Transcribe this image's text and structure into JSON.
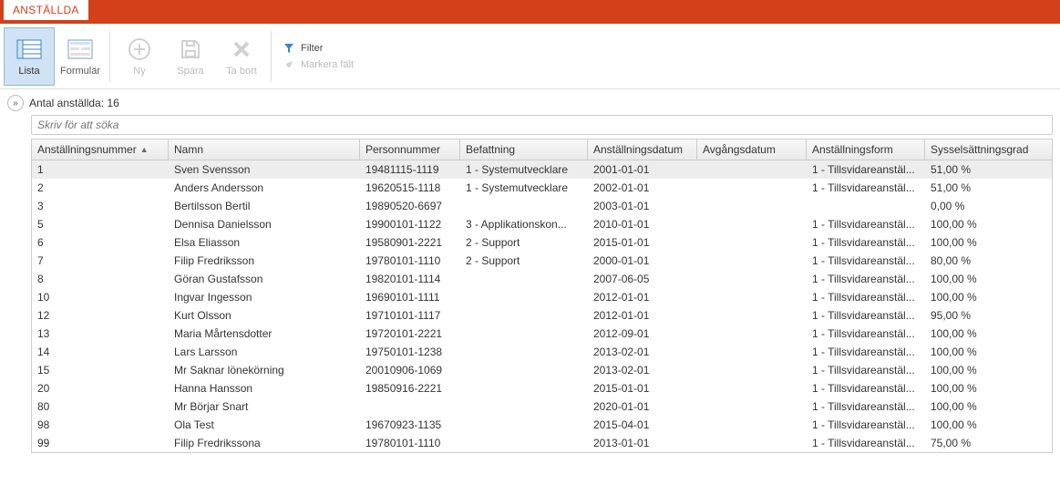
{
  "header": {
    "tab": "ANSTÄLLDA"
  },
  "toolbar": {
    "lista": "Lista",
    "formular": "Formulär",
    "ny": "Ny",
    "spara": "Spara",
    "tabort": "Ta bort",
    "filter": "Filter",
    "markera": "Markera fält"
  },
  "summary": {
    "label": "Antal anställda: 16"
  },
  "search": {
    "placeholder": "Skriv för att söka"
  },
  "columns": [
    "Anställningsnummer",
    "Namn",
    "Personnummer",
    "Befattning",
    "Anställningsdatum",
    "Avgångsdatum",
    "Anställningsform",
    "Sysselsättningsgrad"
  ],
  "rows": [
    {
      "anstnr": "1",
      "namn": "Sven Svensson",
      "pnr": "19481115-1119",
      "befattning": "1 - Systemutvecklare",
      "anstdatum": "2001-01-01",
      "avgangs": "",
      "form": "1 - Tillsvidareanstäl...",
      "grad": "51,00 %"
    },
    {
      "anstnr": "2",
      "namn": "Anders Andersson",
      "pnr": "19620515-1118",
      "befattning": "1 - Systemutvecklare",
      "anstdatum": "2002-01-01",
      "avgangs": "",
      "form": "1 - Tillsvidareanstäl...",
      "grad": "51,00 %"
    },
    {
      "anstnr": "3",
      "namn": "Bertilsson Bertil",
      "pnr": "19890520-6697",
      "befattning": "",
      "anstdatum": "2003-01-01",
      "avgangs": "",
      "form": "",
      "grad": "0,00 %"
    },
    {
      "anstnr": "5",
      "namn": "Dennisa Danielsson",
      "pnr": "19900101-1122",
      "befattning": "3 - Applikationskon...",
      "anstdatum": "2010-01-01",
      "avgangs": "",
      "form": "1 - Tillsvidareanstäl...",
      "grad": "100,00 %"
    },
    {
      "anstnr": "6",
      "namn": "Elsa Eliasson",
      "pnr": "19580901-2221",
      "befattning": "2 - Support",
      "anstdatum": "2015-01-01",
      "avgangs": "",
      "form": "1 - Tillsvidareanstäl...",
      "grad": "100,00 %"
    },
    {
      "anstnr": "7",
      "namn": "Filip Fredriksson",
      "pnr": "19780101-1110",
      "befattning": "2 - Support",
      "anstdatum": "2000-01-01",
      "avgangs": "",
      "form": "1 - Tillsvidareanstäl...",
      "grad": "80,00 %"
    },
    {
      "anstnr": "8",
      "namn": "Göran Gustafsson",
      "pnr": "19820101-1114",
      "befattning": "",
      "anstdatum": "2007-06-05",
      "avgangs": "",
      "form": "1 - Tillsvidareanstäl...",
      "grad": "100,00 %"
    },
    {
      "anstnr": "10",
      "namn": "Ingvar Ingesson",
      "pnr": "19690101-1111",
      "befattning": "",
      "anstdatum": "2012-01-01",
      "avgangs": "",
      "form": "1 - Tillsvidareanstäl...",
      "grad": "100,00 %"
    },
    {
      "anstnr": "12",
      "namn": "Kurt Olsson",
      "pnr": "19710101-1117",
      "befattning": "",
      "anstdatum": "2012-01-01",
      "avgangs": "",
      "form": "1 - Tillsvidareanstäl...",
      "grad": "95,00 %"
    },
    {
      "anstnr": "13",
      "namn": "Maria Mårtensdotter",
      "pnr": "19720101-2221",
      "befattning": "",
      "anstdatum": "2012-09-01",
      "avgangs": "",
      "form": "1 - Tillsvidareanstäl...",
      "grad": "100,00 %"
    },
    {
      "anstnr": "14",
      "namn": "Lars Larsson",
      "pnr": "19750101-1238",
      "befattning": "",
      "anstdatum": "2013-02-01",
      "avgangs": "",
      "form": "1 - Tillsvidareanstäl...",
      "grad": "100,00 %"
    },
    {
      "anstnr": "15",
      "namn": "Mr Saknar lönekörning",
      "pnr": "20010906-1069",
      "befattning": "",
      "anstdatum": "2013-02-01",
      "avgangs": "",
      "form": "1 - Tillsvidareanstäl...",
      "grad": "100,00 %"
    },
    {
      "anstnr": "20",
      "namn": "Hanna Hansson",
      "pnr": "19850916-2221",
      "befattning": "",
      "anstdatum": "2015-01-01",
      "avgangs": "",
      "form": "1 - Tillsvidareanstäl...",
      "grad": "100,00 %"
    },
    {
      "anstnr": "80",
      "namn": "Mr Börjar Snart",
      "pnr": "",
      "befattning": "",
      "anstdatum": "2020-01-01",
      "avgangs": "",
      "form": "1 - Tillsvidareanstäl...",
      "grad": "100,00 %"
    },
    {
      "anstnr": "98",
      "namn": "Ola Test",
      "pnr": "19670923-1135",
      "befattning": "",
      "anstdatum": "2015-04-01",
      "avgangs": "",
      "form": "1 - Tillsvidareanstäl...",
      "grad": "100,00 %"
    },
    {
      "anstnr": "99",
      "namn": "Filip Fredrikssona",
      "pnr": "19780101-1110",
      "befattning": "",
      "anstdatum": "2013-01-01",
      "avgangs": "",
      "form": "1 - Tillsvidareanstäl...",
      "grad": "75,00 %"
    }
  ]
}
